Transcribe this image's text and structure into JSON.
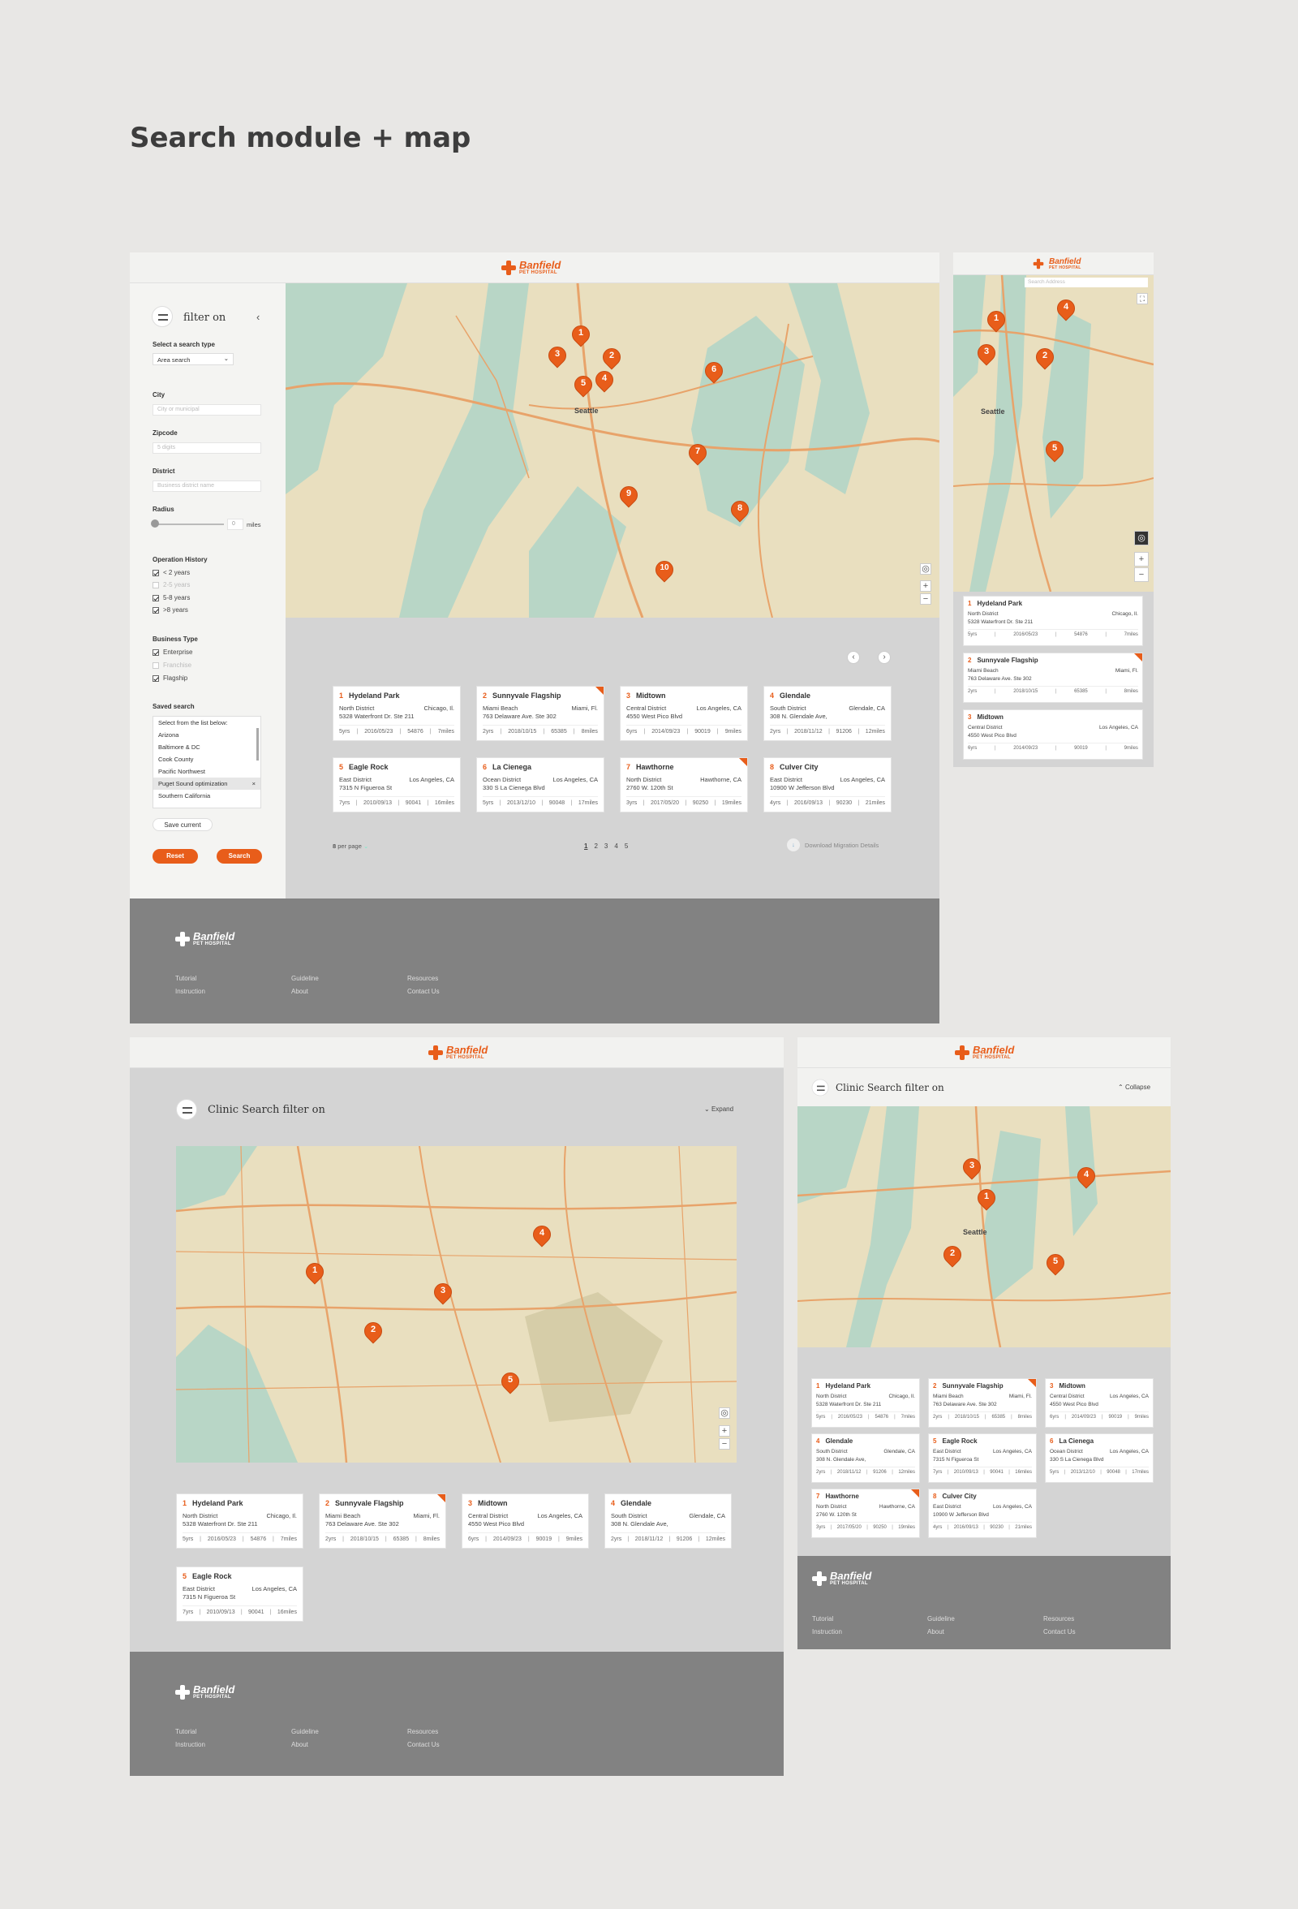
{
  "page_title": "Search module + map",
  "brand": {
    "name": "Banfield",
    "sub": "PET HOSPITAL",
    "accent": "#e85d1a"
  },
  "filter": {
    "title": "filter on",
    "search_type_label": "Select a search type",
    "search_type_value": "Area search",
    "city_label": "City",
    "city_placeholder": "City or municipal",
    "zip_label": "Zipcode",
    "zip_placeholder": "5 digits",
    "district_label": "District",
    "district_placeholder": "Business district name",
    "radius_label": "Radius",
    "radius_value": "0",
    "radius_unit": "miles",
    "op_history_label": "Operation History",
    "op_history": [
      {
        "label": "< 2 years",
        "checked": true
      },
      {
        "label": "2-5 years",
        "checked": false
      },
      {
        "label": "5-8 years",
        "checked": true
      },
      {
        "label": ">8 years",
        "checked": true
      }
    ],
    "business_type_label": "Business Type",
    "business_type": [
      {
        "label": "Enterprise",
        "checked": true
      },
      {
        "label": "Franchise",
        "checked": false
      },
      {
        "label": "Flagship",
        "checked": true
      }
    ],
    "saved_label": "Saved search",
    "saved_list": [
      "Select from the list below:",
      "Arizona",
      "Baltimore & DC",
      "Cook County",
      "Pacific Northwest",
      "Puget Sound optimization",
      "Southern California"
    ],
    "save_current": "Save current",
    "reset": "Reset",
    "search": "Search"
  },
  "map_labels": {
    "seattle": "Seattle",
    "search_placeholder": "Search Address",
    "collapse": "Collapse",
    "expand": "Expand",
    "clinic_filter": "Clinic Search filter on"
  },
  "clinics": [
    {
      "n": "1",
      "name": "Hydeland Park",
      "district": "North District",
      "city": "Chicago, Il.",
      "address": "5328 Waterfront Dr. Ste 211",
      "yrs": "5yrs",
      "date": "2016/05/23",
      "code": "54876",
      "dist": "7miles",
      "flag": false
    },
    {
      "n": "2",
      "name": "Sunnyvale Flagship",
      "district": "Miami Beach",
      "city": "Miami, Fl.",
      "address": "763 Delaware Ave. Ste 302",
      "yrs": "2yrs",
      "date": "2018/10/15",
      "code": "65385",
      "dist": "8miles",
      "flag": true
    },
    {
      "n": "3",
      "name": "Midtown",
      "district": "Central District",
      "city": "Los Angeles, CA",
      "address": "4550 West Pico Blvd",
      "yrs": "6yrs",
      "date": "2014/09/23",
      "code": "90019",
      "dist": "9miles",
      "flag": false
    },
    {
      "n": "4",
      "name": "Glendale",
      "district": "South District",
      "city": "Glendale, CA",
      "address": "308 N. Glendale Ave,",
      "yrs": "2yrs",
      "date": "2018/11/12",
      "code": "91206",
      "dist": "12miles",
      "flag": false
    },
    {
      "n": "5",
      "name": "Eagle Rock",
      "district": "East District",
      "city": "Los Angeles, CA",
      "address": "7315 N Figueroa St",
      "yrs": "7yrs",
      "date": "2010/09/13",
      "code": "90041",
      "dist": "16miles",
      "flag": false
    },
    {
      "n": "6",
      "name": "La Cienega",
      "district": "Ocean District",
      "city": "Los Angeles, CA",
      "address": "330 S La Cienega Blvd",
      "yrs": "5yrs",
      "date": "2013/12/10",
      "code": "90048",
      "dist": "17miles",
      "flag": false
    },
    {
      "n": "7",
      "name": "Hawthorne",
      "district": "North District",
      "city": "Hawthorne, CA",
      "address": "2760 W. 120th St",
      "yrs": "3yrs",
      "date": "2017/05/20",
      "code": "90250",
      "dist": "19miles",
      "flag": true
    },
    {
      "n": "8",
      "name": "Culver City",
      "district": "East District",
      "city": "Los Angeles, CA",
      "address": "10900 W Jefferson Blvd",
      "yrs": "4yrs",
      "date": "2016/09/13",
      "code": "90230",
      "dist": "21miles",
      "flag": false
    }
  ],
  "pagination": {
    "per_page": "8",
    "per_page_label": "per page",
    "pages": [
      "1",
      "2",
      "3",
      "4",
      "5"
    ],
    "download": "Download Migration Details"
  },
  "footer": {
    "tutorial": "Tutorial",
    "instruction": "Instruction",
    "guideline": "Guideline",
    "about": "About",
    "resources": "Resources",
    "contact": "Contact Us"
  }
}
